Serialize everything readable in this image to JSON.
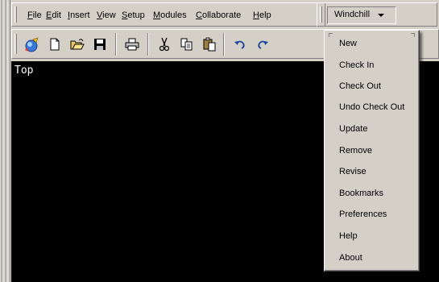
{
  "menubar": {
    "items": [
      {
        "label": "File"
      },
      {
        "label": "Edit"
      },
      {
        "label": "Insert"
      },
      {
        "label": "View"
      },
      {
        "label": "Setup"
      },
      {
        "label": "Modules"
      },
      {
        "label": "Collaborate"
      },
      {
        "label": "Help"
      }
    ]
  },
  "windchill": {
    "button_label": "Windchill",
    "menu": [
      {
        "label": "New"
      },
      {
        "label": "Check In"
      },
      {
        "label": "Check Out"
      },
      {
        "label": "Undo Check Out"
      },
      {
        "label": "Update"
      },
      {
        "label": "Remove"
      },
      {
        "label": "Revise"
      },
      {
        "label": "Bookmarks"
      },
      {
        "label": "Preferences"
      },
      {
        "label": "Help"
      },
      {
        "label": "About"
      }
    ]
  },
  "toolbar": {
    "icons": [
      "wizard-icon",
      "new-file-icon",
      "open-folder-icon",
      "save-icon",
      "print-icon",
      "cut-icon",
      "copy-icon",
      "paste-icon",
      "undo-icon",
      "redo-icon"
    ]
  },
  "viewport": {
    "label": "Top"
  },
  "colors": {
    "chrome": "#d4d0c8",
    "viewport_bg": "#000000",
    "viewport_text": "#ffffff"
  }
}
